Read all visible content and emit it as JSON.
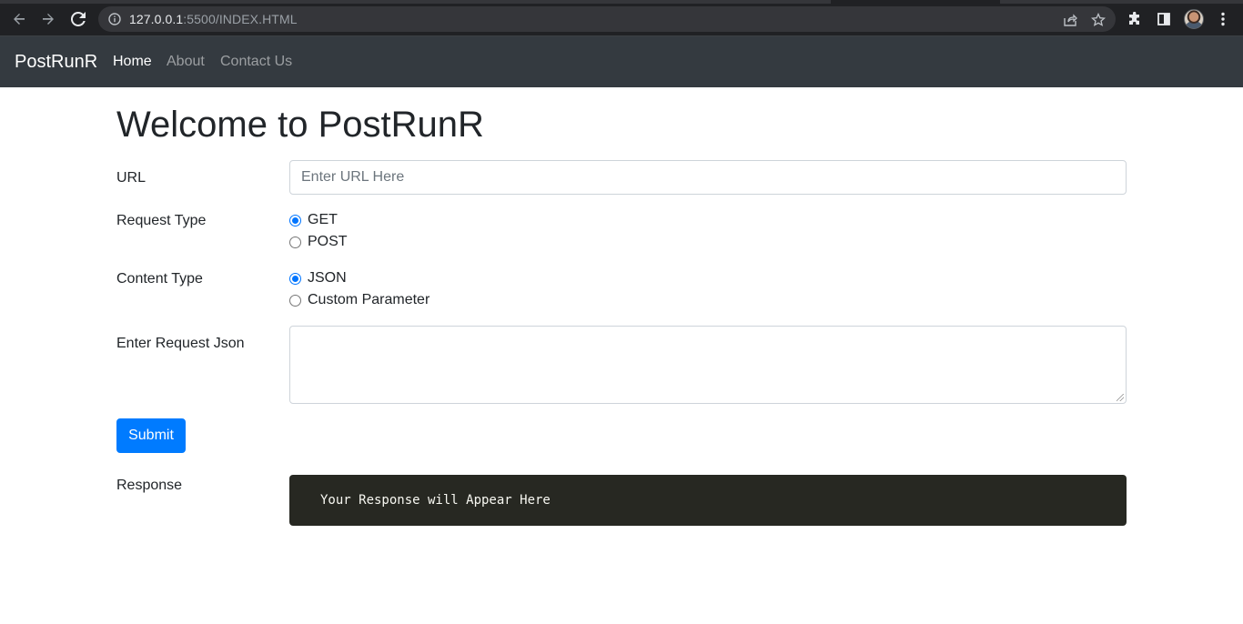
{
  "browser": {
    "url_host": "127.0.0.1",
    "url_rest": ":5500/INDEX.HTML"
  },
  "icons": {
    "back": "arrow-left-icon",
    "forward": "arrow-right-icon",
    "reload": "reload-icon",
    "info": "info-icon",
    "share": "share-icon",
    "star": "star-icon",
    "extensions": "puzzle-icon",
    "side_panel": "side-panel-icon",
    "menu": "kebab-menu-icon"
  },
  "navbar": {
    "brand": "PostRunR",
    "links": [
      {
        "label": "Home",
        "active": true
      },
      {
        "label": "About",
        "active": false
      },
      {
        "label": "Contact Us",
        "active": false
      }
    ]
  },
  "page": {
    "title": "Welcome to PostRunR",
    "url_label": "URL",
    "url_placeholder": "Enter URL Here",
    "url_value": "",
    "request_type_label": "Request Type",
    "request_types": [
      {
        "label": "GET",
        "checked": true
      },
      {
        "label": "POST",
        "checked": false
      }
    ],
    "content_type_label": "Content Type",
    "content_types": [
      {
        "label": "JSON",
        "checked": true
      },
      {
        "label": "Custom Parameter",
        "checked": false
      }
    ],
    "request_json_label": "Enter Request Json",
    "request_json_value": "",
    "submit_label": "Submit",
    "response_label": "Response",
    "response_text": "Your Response will Appear Here"
  },
  "colors": {
    "navbar_bg": "#343a40",
    "primary": "#007bff",
    "response_bg": "#272822"
  }
}
